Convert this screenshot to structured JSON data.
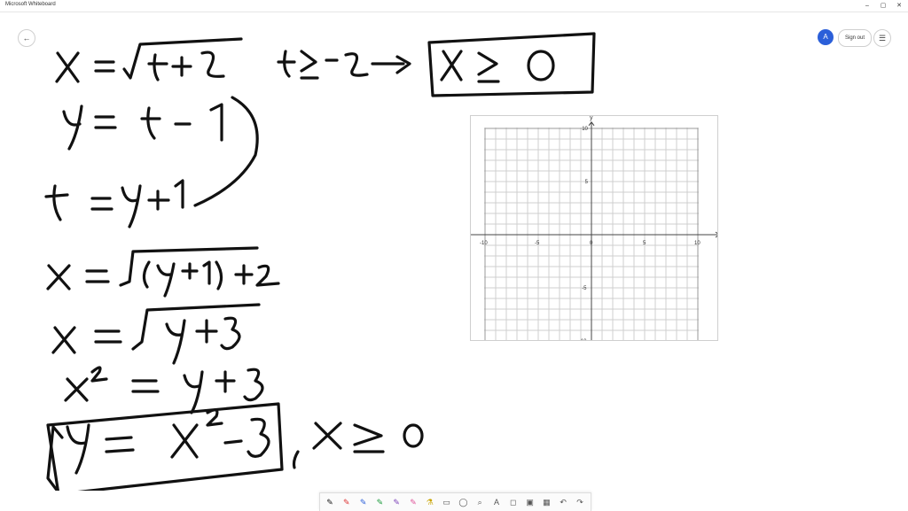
{
  "window": {
    "title": "Microsoft Whiteboard",
    "minimize": "–",
    "maximize": "▢",
    "close": "✕"
  },
  "toolbar_top": {
    "back": "←",
    "avatar": "A",
    "sign_out": "Sign out",
    "menu": "☰"
  },
  "graph": {
    "axis_x": "x",
    "axis_y": "y",
    "x_ticks": [
      "-10",
      "-5",
      "0",
      "5",
      "10"
    ],
    "y_ticks": [
      "10",
      "5",
      "-5",
      "-10"
    ]
  },
  "ink_icons": [
    "pen-icon",
    "pen-red-icon",
    "pen-blue-icon",
    "pen-green-icon",
    "pen-purple-icon",
    "pen-pink-icon",
    "highlighter-icon",
    "eraser-icon",
    "ruler-icon",
    "lasso-icon",
    "text-icon",
    "shape-icon",
    "sticky-note-icon",
    "image-icon",
    "undo-icon",
    "redo-icon"
  ],
  "colors": {
    "accent": "#2b5fd9",
    "ink": "#111111"
  }
}
